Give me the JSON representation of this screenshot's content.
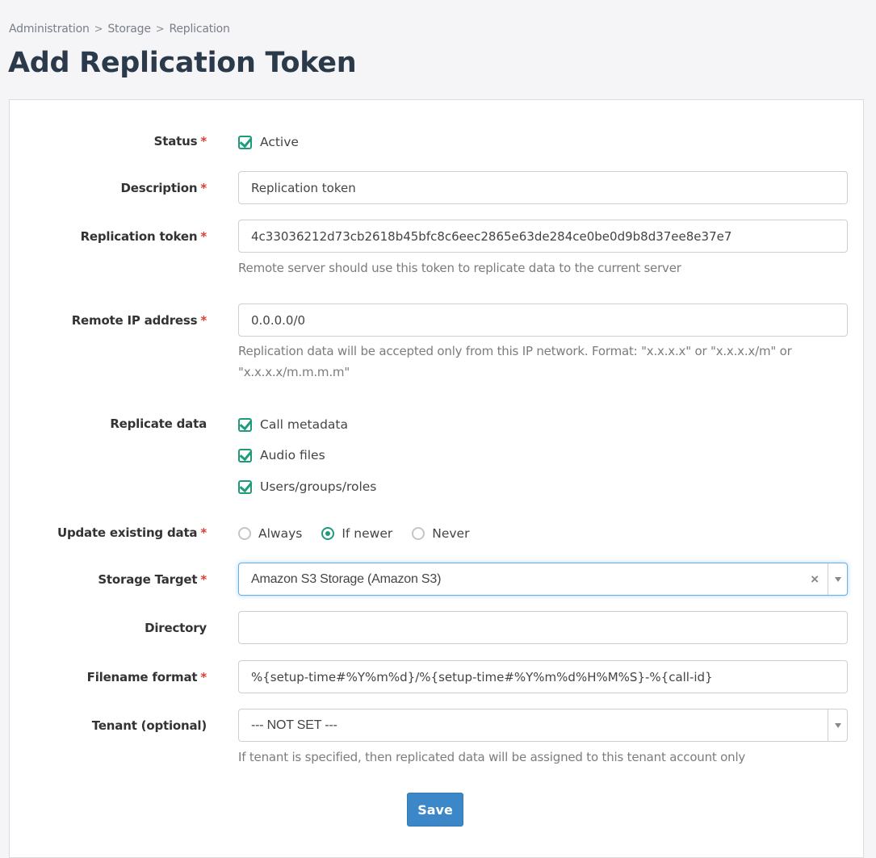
{
  "breadcrumb": [
    "Administration",
    "Storage",
    "Replication"
  ],
  "page_title": "Add Replication Token",
  "form": {
    "status": {
      "label": "Status",
      "required": "*",
      "checkbox_label": "Active",
      "checked": true
    },
    "description": {
      "label": "Description",
      "required": "*",
      "value": "Replication token"
    },
    "replication_token": {
      "label": "Replication token",
      "required": "*",
      "value": "4c33036212d73cb2618b45bfc8c6eec2865e63de284ce0be0d9b8d37ee8e37e7",
      "help": "Remote server should use this token to replicate data to the current server"
    },
    "remote_ip": {
      "label": "Remote IP address",
      "required": "*",
      "value": "0.0.0.0/0",
      "help": "Replication data will be accepted only from this IP network. Format: \"x.x.x.x\" or \"x.x.x.x/m\" or \"x.x.x.x/m.m.m.m\""
    },
    "replicate_data": {
      "label": "Replicate data",
      "options": [
        {
          "label": "Call metadata",
          "checked": true
        },
        {
          "label": "Audio files",
          "checked": true
        },
        {
          "label": "Users/groups/roles",
          "checked": true
        }
      ]
    },
    "update_existing": {
      "label": "Update existing data",
      "required": "*",
      "options": [
        "Always",
        "If newer",
        "Never"
      ],
      "selected": "If newer"
    },
    "storage_target": {
      "label": "Storage Target",
      "required": "*",
      "value": "Amazon S3 Storage (Amazon S3)",
      "clear_icon": "×"
    },
    "directory": {
      "label": "Directory",
      "value": ""
    },
    "filename_format": {
      "label": "Filename format",
      "required": "*",
      "value": "%{setup-time#%Y%m%d}/%{setup-time#%Y%m%d%H%M%S}-%{call-id}"
    },
    "tenant": {
      "label": "Tenant (optional)",
      "value": "--- NOT SET ---",
      "help": "If tenant is specified, then replicated data will be assigned to this tenant account only"
    },
    "save_label": "Save"
  },
  "colors": {
    "accent": "#1f9b7c",
    "primary_button": "#3c87c8",
    "required": "#e03c31",
    "title": "#2b3a4a"
  }
}
